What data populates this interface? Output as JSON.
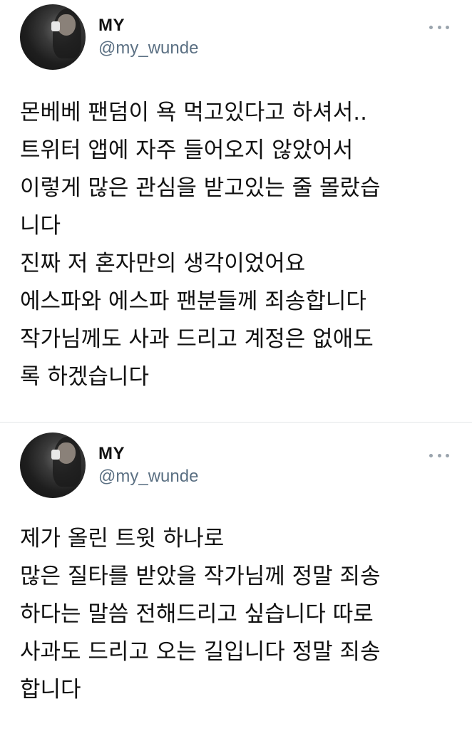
{
  "tweets": [
    {
      "display_name": "MY",
      "handle": "@my_wunde",
      "menu_icon": "more-icon",
      "lines": [
        "몬베베 팬덤이 욕 먹고있다고 하셔서..",
        "트위터 앱에 자주 들어오지 않았어서",
        "이렇게 많은 관심을 받고있는 줄 몰랐습",
        "니다",
        "진짜 저 혼자만의 생각이었어요",
        "에스파와 에스파 팬분들께 죄송합니다",
        "작가님께도 사과 드리고 계정은 없애도",
        "록 하겠습니다"
      ]
    },
    {
      "display_name": "MY",
      "handle": "@my_wunde",
      "menu_icon": "more-icon",
      "lines": [
        "제가 올린 트윗 하나로",
        "많은 질타를 받았을 작가님께 정말 죄송",
        "하다는 말씀 전해드리고 싶습니다 따로",
        "사과도 드리고 오는 길입니다 정말 죄송",
        "합니다"
      ]
    }
  ],
  "colors": {
    "text": "#111111",
    "handle": "#5b7083",
    "divider": "#e3e6e8",
    "background": "#ffffff"
  }
}
